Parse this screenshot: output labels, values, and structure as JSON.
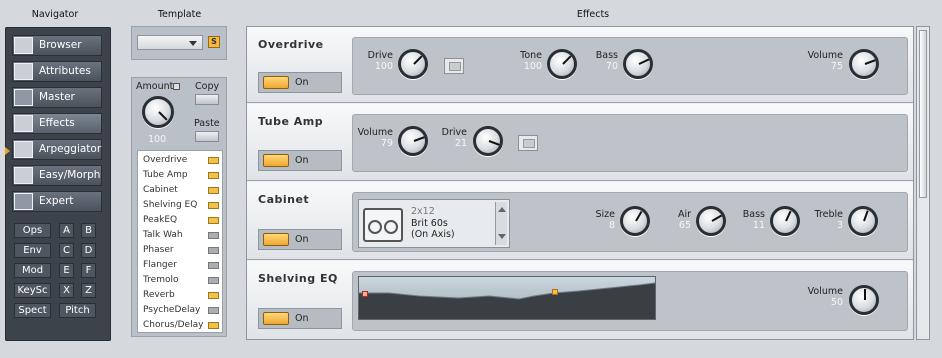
{
  "headers": {
    "navigator": "Navigator",
    "template": "Template",
    "effects": "Effects"
  },
  "navigator": {
    "items": [
      {
        "label": "Browser",
        "icon": "list-icon"
      },
      {
        "label": "Attributes",
        "icon": "attributes-icon"
      },
      {
        "label": "Master",
        "icon": "gear-icon"
      },
      {
        "label": "Effects",
        "icon": "effects-icon",
        "active": true
      },
      {
        "label": "Arpeggiator",
        "icon": "arpeggiator-icon"
      },
      {
        "label": "Easy/Morph",
        "icon": "grid-icon"
      },
      {
        "label": "Expert",
        "icon": "expert-icon"
      }
    ],
    "small": [
      [
        "Ops",
        "A",
        "B"
      ],
      [
        "Env",
        "C",
        "D"
      ],
      [
        "Mod",
        "E",
        "F"
      ],
      [
        "KeySc",
        "X",
        "Z"
      ],
      [
        "Spect",
        "Pitch"
      ]
    ]
  },
  "template": {
    "s_label": "S"
  },
  "amount": {
    "label": "Amount",
    "value": "100",
    "copy": "Copy",
    "paste": "Paste"
  },
  "fxlist": [
    {
      "name": "Overdrive",
      "on": true
    },
    {
      "name": "Tube Amp",
      "on": true
    },
    {
      "name": "Cabinet",
      "on": true
    },
    {
      "name": "Shelving EQ",
      "on": true
    },
    {
      "name": "PeakEQ",
      "on": true
    },
    {
      "name": "Talk Wah",
      "on": false
    },
    {
      "name": "Phaser",
      "on": false
    },
    {
      "name": "Flanger",
      "on": false
    },
    {
      "name": "Tremolo",
      "on": false
    },
    {
      "name": "Reverb",
      "on": true
    },
    {
      "name": "PsycheDelay",
      "on": false
    },
    {
      "name": "Chorus/Delay",
      "on": true
    }
  ],
  "effects": {
    "on_label": "On",
    "overdrive": {
      "name": "Overdrive",
      "drive_label": "Drive",
      "drive": "100",
      "tone_label": "Tone",
      "tone": "100",
      "bass_label": "Bass",
      "bass": "70",
      "volume_label": "Volume",
      "volume": "75"
    },
    "tubeamp": {
      "name": "Tube Amp",
      "volume_label": "Volume",
      "volume": "79",
      "drive_label": "Drive",
      "drive": "21"
    },
    "cabinet": {
      "name": "Cabinet",
      "cab_line1": "2x12",
      "cab_line2": "Brit 60s",
      "cab_line3": "(On Axis)",
      "size_label": "Size",
      "size": "8",
      "air_label": "Air",
      "air": "65",
      "bass_label": "Bass",
      "bass": "11",
      "treble_label": "Treble",
      "treble": "3"
    },
    "shelving": {
      "name": "Shelving EQ",
      "volume_label": "Volume",
      "volume": "50"
    }
  },
  "colors": {
    "accent": "#f0a830",
    "panel": "#3d434b"
  }
}
